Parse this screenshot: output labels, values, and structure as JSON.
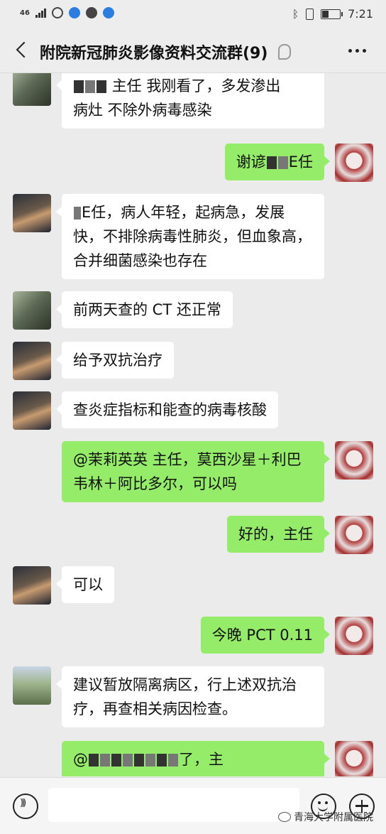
{
  "statusbar": {
    "network": "46",
    "time": "7:21"
  },
  "header": {
    "title": "附院新冠肺炎影像资料交流群(9)"
  },
  "messages": [
    {
      "side": "in",
      "avatar": "woman-icon",
      "text": "主任 我刚看了，多发渗出\n病灶 不除外病毒感染"
    },
    {
      "side": "out",
      "avatar": "hospital-seal-icon",
      "text_a": "谢谚",
      "text_b": "E任"
    },
    {
      "side": "in",
      "avatar": "night-scene-icon",
      "text": "E任，病人年轻，起病急，发展\n快，不排除病毒性肺炎，但血象高，\n合并细菌感染也存在"
    },
    {
      "side": "in",
      "avatar": "woman-icon",
      "text": "前两天查的 CT 还正常"
    },
    {
      "side": "in",
      "avatar": "night-scene-icon",
      "text": "给予双抗治疗"
    },
    {
      "side": "in",
      "avatar": "night-scene-icon",
      "text": "查炎症指标和能查的病毒核酸"
    },
    {
      "side": "out",
      "avatar": "hospital-seal-icon",
      "text": "@茉莉英英  主任，莫西沙星＋利巴\n韦林＋阿比多尔，可以吗"
    },
    {
      "side": "out",
      "avatar": "hospital-seal-icon",
      "text": "好的，主任"
    },
    {
      "side": "in",
      "avatar": "night-scene-icon",
      "text": "可以"
    },
    {
      "side": "out",
      "avatar": "hospital-seal-icon",
      "text": "今晚 PCT 0.11"
    },
    {
      "side": "in",
      "avatar": "garden-icon",
      "text": "建议暂放隔离病区，行上述双抗治\n疗，再查相关病因检查。"
    },
    {
      "side": "out",
      "avatar": "hospital-seal-icon",
      "text_a": "@",
      "text_b": "了，主"
    }
  ],
  "watermark": "青海大学附属医院"
}
